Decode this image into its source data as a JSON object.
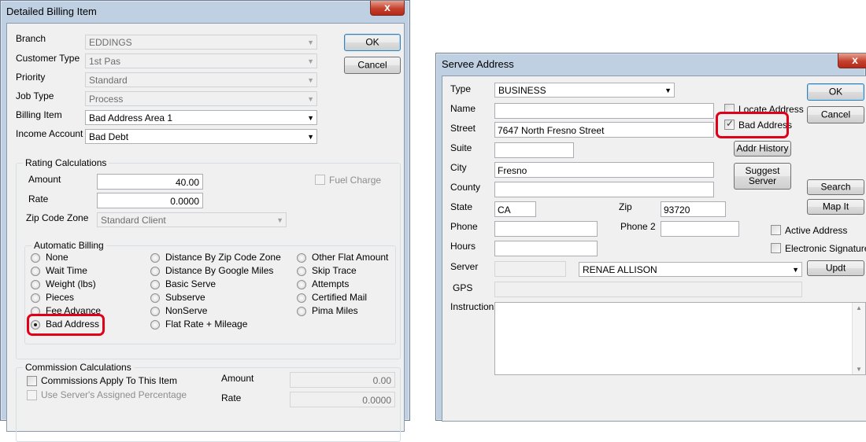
{
  "left": {
    "title": "Detailed Billing Item",
    "close": "x",
    "fields": {
      "branch_label": "Branch",
      "branch_value": "EDDINGS",
      "customer_type_label": "Customer Type",
      "customer_type_value": "1st Pas",
      "priority_label": "Priority",
      "priority_value": "Standard",
      "job_type_label": "Job Type",
      "job_type_value": "Process",
      "billing_item_label": "Billing Item",
      "billing_item_value": "Bad Address Area 1",
      "income_account_label": "Income Account",
      "income_account_value": "Bad Debt"
    },
    "buttons": {
      "ok": "OK",
      "cancel": "Cancel"
    },
    "rating": {
      "title": "Rating Calculations",
      "amount_label": "Amount",
      "amount_value": "40.00",
      "rate_label": "Rate",
      "rate_value": "0.0000",
      "zip_zone_label": "Zip Code Zone",
      "zip_zone_value": "Standard Client",
      "fuel_charge_label": "Fuel Charge"
    },
    "auto_billing": {
      "title": "Automatic Billing",
      "col1": [
        "None",
        "Wait Time",
        "Weight (lbs)",
        "Pieces",
        "Fee Advance",
        "Bad Address"
      ],
      "col2": [
        "Distance By Zip Code Zone",
        "Distance By Google Miles",
        "Basic Serve",
        "Subserve",
        "NonServe",
        "Flat Rate + Mileage"
      ],
      "col3": [
        "Other Flat Amount",
        "Skip Trace",
        "Attempts",
        "Certified Mail",
        "Pima Miles"
      ],
      "selected": "Bad Address"
    },
    "commission": {
      "title": "Commission Calculations",
      "applies_label": "Commissions Apply To This Item",
      "use_server_label": "Use Server's Assigned  Percentage",
      "amount_label": "Amount",
      "amount_value": "0.00",
      "rate_label": "Rate",
      "rate_value": "0.0000"
    }
  },
  "right": {
    "title": "Servee Address",
    "close": "x",
    "type_label": "Type",
    "type_value": "BUSINESS",
    "name_label": "Name",
    "name_value": "",
    "street_label": "Street",
    "street_value": "7647 North Fresno Street",
    "suite_label": "Suite",
    "suite_value": "",
    "city_label": "City",
    "city_value": "Fresno",
    "county_label": "County",
    "county_value": "",
    "state_label": "State",
    "state_value": "CA",
    "zip_label": "Zip",
    "zip_value": "93720",
    "phone_label": "Phone",
    "phone_value": "",
    "phone2_label": "Phone 2",
    "phone2_value": "",
    "hours_label": "Hours",
    "hours_value": "",
    "server_label": "Server",
    "server_value": "RENAE ALLISON",
    "gps_label": "GPS",
    "instructions_label": "Instructions",
    "locate_address_label": "Locate Address",
    "bad_address_label": "Bad Address",
    "active_address_label": "Active Address",
    "electronic_signature_label": "Electronic Signature",
    "buttons": {
      "ok": "OK",
      "cancel": "Cancel",
      "addr_history": "Addr History",
      "suggest_server_1": "Suggest",
      "suggest_server_2": "Server",
      "search": "Search",
      "map_it": "Map It",
      "updt": "Updt"
    }
  },
  "colors": {
    "highlight": "#e0001a",
    "frame": "#bfd0e3"
  }
}
